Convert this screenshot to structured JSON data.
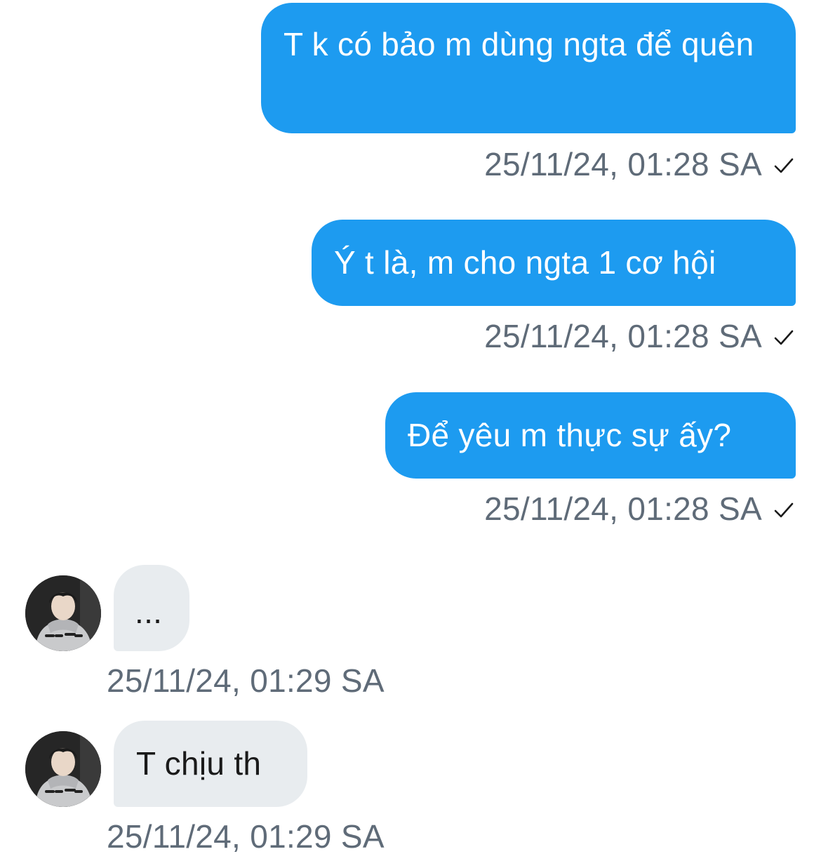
{
  "thread": {
    "messages": [
      {
        "direction": "outgoing",
        "text": "T k có bảo m dùng ngta để quên",
        "timestamp": "25/11/24, 01:28 SA",
        "status_icon": "check-icon"
      },
      {
        "direction": "outgoing",
        "text": "Ý t là, m cho ngta 1 cơ hội",
        "timestamp": "25/11/24, 01:28 SA",
        "status_icon": "check-icon"
      },
      {
        "direction": "outgoing",
        "text": "Để yêu m thực sự ấy?",
        "timestamp": "25/11/24, 01:28 SA",
        "status_icon": "check-icon"
      },
      {
        "direction": "incoming",
        "text": "...",
        "timestamp": "25/11/24, 01:29 SA",
        "avatar_icon": "avatar"
      },
      {
        "direction": "incoming",
        "text": "T chịu th",
        "timestamp": "25/11/24, 01:29 SA",
        "avatar_icon": "avatar"
      }
    ]
  },
  "colors": {
    "outgoing_bubble": "#1d9bf0",
    "incoming_bubble": "#e8ecef",
    "timestamp_text": "#5f6b78",
    "outgoing_text": "#ffffff",
    "incoming_text": "#1a1a1a"
  }
}
